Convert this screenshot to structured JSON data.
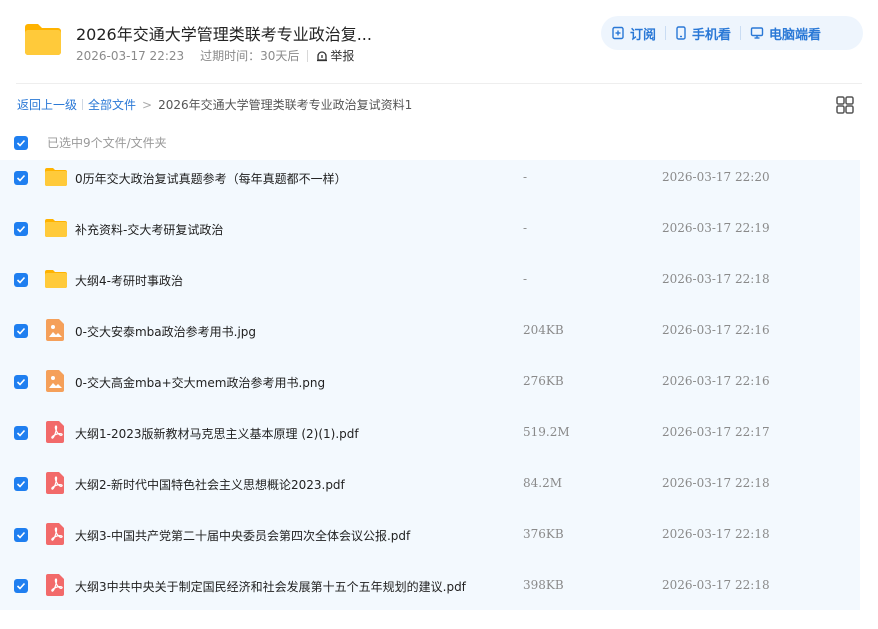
{
  "header": {
    "title": "2026年交通大学管理类联考专业政治复...",
    "created": "2026-03-17 22:23",
    "expire": "过期时间：30天后",
    "report": "举报"
  },
  "actions": {
    "subscribe": "订阅",
    "mobile": "手机看",
    "desktop": "电脑端看"
  },
  "breadcrumb": {
    "back": "返回上一级",
    "all": "全部文件",
    "current": "2026年交通大学管理类联考专业政治复试资料1"
  },
  "selection": {
    "text": "已选中9个文件/文件夹"
  },
  "colors": {
    "accent": "#2a78d6",
    "checkbox": "#1f7ff0",
    "folder": "#ffc53d",
    "image": "#f5a05a",
    "pdf": "#f26a6a"
  },
  "files": [
    {
      "type": "folder",
      "name": "0历年交大政治复试真题参考（每年真题都不一样）",
      "size": "-",
      "date": "2026-03-17 22:20"
    },
    {
      "type": "folder",
      "name": "补充资料-交大考研复试政治",
      "size": "-",
      "date": "2026-03-17 22:19"
    },
    {
      "type": "folder",
      "name": "大纲4-考研时事政治",
      "size": "-",
      "date": "2026-03-17 22:18"
    },
    {
      "type": "image",
      "name": "0-交大安泰mba政治参考用书.jpg",
      "size": "204KB",
      "date": "2026-03-17 22:16"
    },
    {
      "type": "image",
      "name": "0-交大高金mba+交大mem政治参考用书.png",
      "size": "276KB",
      "date": "2026-03-17 22:16"
    },
    {
      "type": "pdf",
      "name": "大纲1-2023版新教材马克思主义基本原理 (2)(1).pdf",
      "size": "519.2M",
      "date": "2026-03-17 22:17"
    },
    {
      "type": "pdf",
      "name": "大纲2-新时代中国特色社会主义思想概论2023.pdf",
      "size": "84.2M",
      "date": "2026-03-17 22:18"
    },
    {
      "type": "pdf",
      "name": "大纲3-中国共产党第二十届中央委员会第四次全体会议公报.pdf",
      "size": "376KB",
      "date": "2026-03-17 22:18"
    },
    {
      "type": "pdf",
      "name": "大纲3中共中央关于制定国民经济和社会发展第十五个五年规划的建议.pdf",
      "size": "398KB",
      "date": "2026-03-17 22:18"
    }
  ]
}
